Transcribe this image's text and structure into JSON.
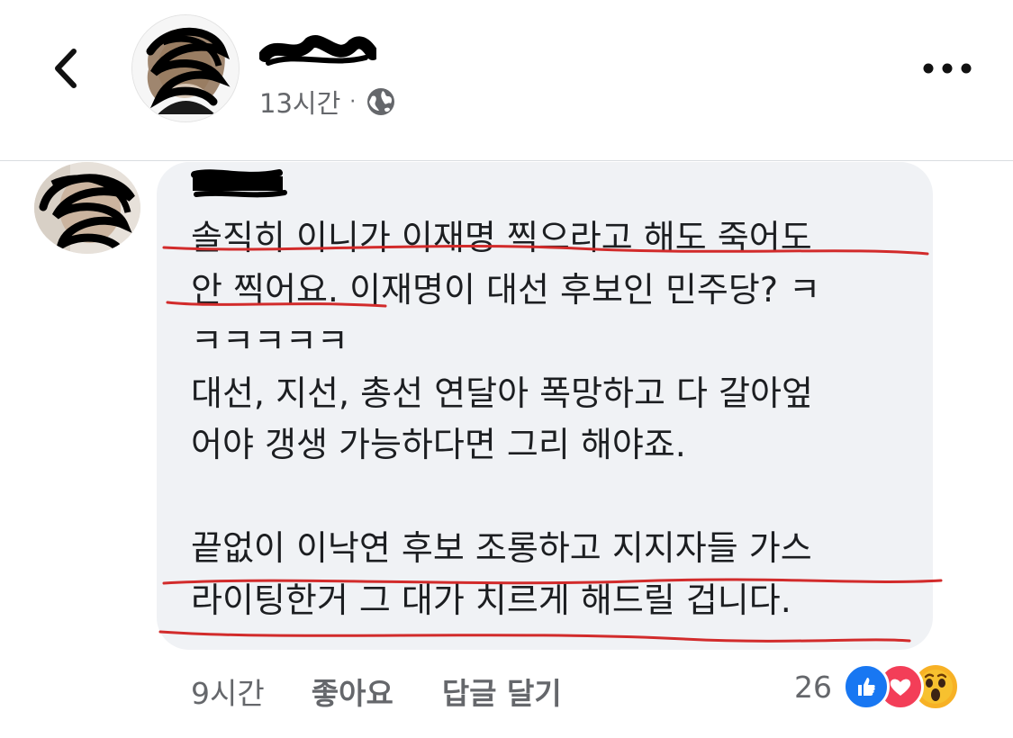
{
  "post": {
    "timestamp": "13시간",
    "separator": "·",
    "privacy_icon": "globe-icon"
  },
  "comment": {
    "lines": [
      "솔직히 이니가 이재명 찍으라고 해도 죽어도",
      "안 찍어요. 이재명이 대선 후보인 민주당? ㅋ",
      "ㅋㅋㅋㅋㅋ",
      "대선, 지선, 총선 연달아 폭망하고 다 갈아엎",
      "어야 갱생 가능하다면 그리 해야죠.",
      "",
      "끝없이 이낙연 후보 조롱하고 지지자들 가스",
      "라이팅한거 그 대가 치르게 해드릴 겁니다."
    ],
    "time": "9시간",
    "like_label": "좋아요",
    "reply_label": "답글 달기",
    "reaction_count": "26",
    "reactions": [
      "like-icon",
      "love-icon",
      "wow-icon"
    ]
  },
  "colors": {
    "bubble": "#f0f2f5",
    "meta_text": "#65676b",
    "like": "#1877f2",
    "love": "#f33e58",
    "wow": "#f7b125",
    "annotation": "#d22b2b"
  }
}
